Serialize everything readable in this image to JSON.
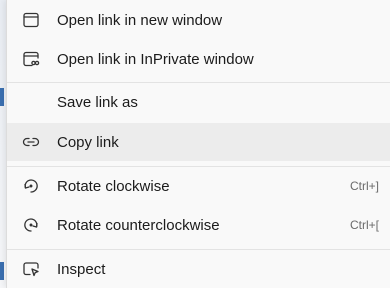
{
  "menu": {
    "items": [
      {
        "label": "Open link in new window",
        "icon": "window-icon",
        "shortcut": ""
      },
      {
        "label": "Open link in InPrivate window",
        "icon": "inprivate-window-icon",
        "shortcut": ""
      },
      {
        "label": "Save link as",
        "icon": "",
        "shortcut": ""
      },
      {
        "label": "Copy link",
        "icon": "link-icon",
        "shortcut": ""
      },
      {
        "label": "Rotate clockwise",
        "icon": "rotate-clockwise-icon",
        "shortcut": "Ctrl+]"
      },
      {
        "label": "Rotate counterclockwise",
        "icon": "rotate-counterclockwise-icon",
        "shortcut": "Ctrl+["
      },
      {
        "label": "Inspect",
        "icon": "inspect-icon",
        "shortcut": ""
      }
    ],
    "highlighted_item": "Copy link",
    "colors": {
      "menu_background": "#f9f9f9",
      "highlight": "#ececec",
      "text": "#1b1b1b",
      "shortcut_text": "#6a6a6a",
      "background_accent": "#3a6fb0"
    }
  }
}
